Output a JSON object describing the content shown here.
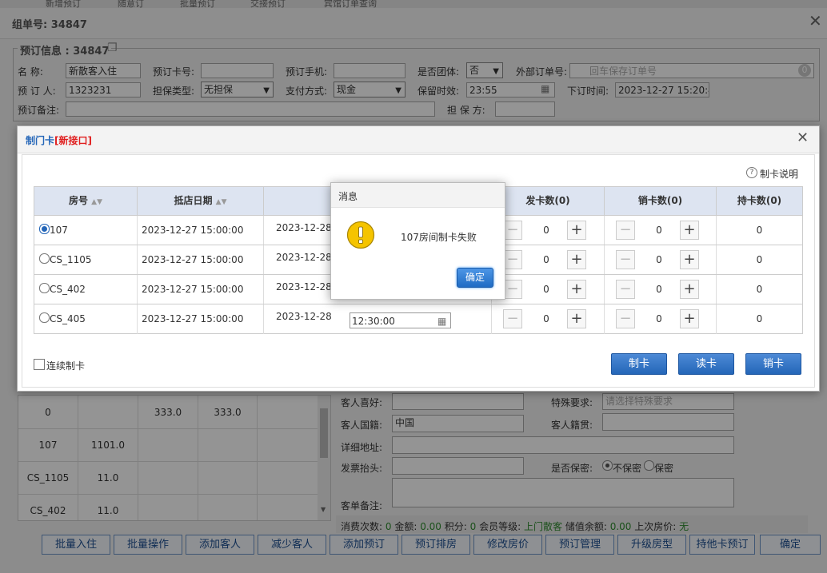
{
  "window": {
    "top_tabs": [
      "",
      "新增预订",
      "随意订",
      "批量预订",
      "交接预订",
      "宾馆订单查询"
    ],
    "title": "组单号: 34847"
  },
  "booking": {
    "section_title": "预订信息 : 34847",
    "name_label": "名    称:",
    "name_value": "新散客入住",
    "card_no_label": "预订卡号:",
    "card_no_value": "",
    "phone_label": "预订手机:",
    "phone_value": "",
    "group_label": "是否团体:",
    "group_value": "否",
    "external_order_label": "外部订单号:",
    "external_order_placeholder": "回车保存订单号",
    "external_badge": "0",
    "booker_label": "预 订 人:",
    "booker_value": "1323231",
    "guarantee_label": "担保类型:",
    "guarantee_value": "无担保",
    "payment_label": "支付方式:",
    "payment_value": "现金",
    "hold_label": "保留时效:",
    "hold_value": "23:55",
    "order_time_label": "下订时间:",
    "order_time_value": "2023-12-27 15:20:4",
    "remark_label": "预订备注:",
    "remark_value": "",
    "guarantor_label": "担 保 方:",
    "guarantor_value": ""
  },
  "room_list": {
    "rows": [
      {
        "c1": "0",
        "c2": "",
        "c3": "333.0",
        "c4": "333.0"
      },
      {
        "c1": "107",
        "c2": "1101.0",
        "c3": "",
        "c4": ""
      },
      {
        "c1": "CS_1105",
        "c2": "11.0",
        "c3": "",
        "c4": ""
      },
      {
        "c1": "CS_402",
        "c2": "11.0",
        "c3": "",
        "c4": ""
      }
    ]
  },
  "guest": {
    "preference_label": "客人喜好:",
    "special_label": "特殊要求:",
    "special_placeholder": "请选择特殊要求",
    "nationality_label": "客人国籍:",
    "nationality_value": "中国",
    "native_label": "客人籍贯:",
    "address_label": "详细地址:",
    "invoice_label": "发票抬头:",
    "privacy_label": "是否保密:",
    "privacy_no": "不保密",
    "privacy_yes": "保密",
    "remark_label": "客单备注:",
    "stats": {
      "consume_label": "消费次数:",
      "consume_value": "0",
      "amount_label": "金额:",
      "amount_value": "0.00",
      "points_label": "积分:",
      "points_value": "0",
      "level_label": "会员等级:",
      "level_value": "上门散客",
      "balance_label": "储值余额:",
      "balance_value": "0.00",
      "last_price_label": "上次房价:",
      "last_price_value": "无"
    }
  },
  "bottom_buttons": [
    "批量入住",
    "批量操作",
    "添加客人",
    "减少客人",
    "添加预订",
    "预订排房",
    "修改房价",
    "预订管理",
    "升级房型",
    "持他卡预订",
    "确定"
  ],
  "card_dialog": {
    "title_prefix": "制门卡",
    "title_suffix": "[新接口]",
    "help_label": "制卡说明",
    "columns": {
      "room": "房号",
      "arrival": "抵店日期",
      "issued": "发卡数(0)",
      "cancelled": "销卡数(0)",
      "holding": "持卡数(0)"
    },
    "rows": [
      {
        "room": "107",
        "arrival": "2023-12-27 15:00:00",
        "depart_date": "2023-12-28",
        "depart_time": "",
        "issued": "0",
        "cancelled": "0",
        "holding": "0",
        "selected": true
      },
      {
        "room": "CS_1105",
        "arrival": "2023-12-27 15:00:00",
        "depart_date": "2023-12-28",
        "depart_time": "",
        "issued": "0",
        "cancelled": "0",
        "holding": "0",
        "selected": false
      },
      {
        "room": "CS_402",
        "arrival": "2023-12-27 15:00:00",
        "depart_date": "2023-12-28",
        "depart_time": "",
        "issued": "0",
        "cancelled": "0",
        "holding": "0",
        "selected": false
      },
      {
        "room": "CS_405",
        "arrival": "2023-12-27 15:00:00",
        "depart_date": "2023-12-28",
        "depart_time": "12:30:00",
        "issued": "0",
        "cancelled": "0",
        "holding": "0",
        "selected": false
      }
    ],
    "continuous_label": "连续制卡",
    "make_button": "制卡",
    "read_button": "读卡",
    "cancel_button": "销卡"
  },
  "message": {
    "title": "消息",
    "text": "107房间制卡失败",
    "ok": "确定"
  },
  "colors": {
    "accent_red": "#e02020",
    "primary_blue": "#2466b8",
    "header_blue": "#dde4f1",
    "warning_yellow": "#f5c400",
    "green_text": "#2e8b2e"
  }
}
